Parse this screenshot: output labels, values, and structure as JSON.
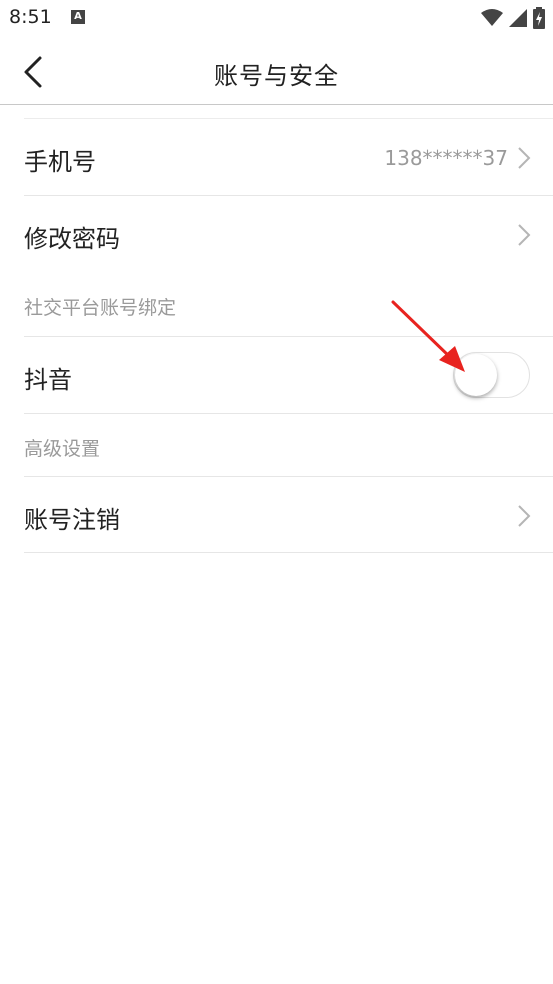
{
  "status_bar": {
    "time": "8:51",
    "notification_icon_letter": "A"
  },
  "header": {
    "title": "账号与安全"
  },
  "rows": {
    "phone": {
      "label": "手机号",
      "value": "138******37"
    },
    "change_password": {
      "label": "修改密码"
    },
    "douyin": {
      "label": "抖音",
      "toggle_on": false
    },
    "cancel_account": {
      "label": "账号注销"
    }
  },
  "sections": {
    "social_binding": "社交平台账号绑定",
    "advanced": "高级设置"
  },
  "colors": {
    "annotation_arrow": "#e8231f",
    "secondary_text": "#9a9a9a"
  }
}
